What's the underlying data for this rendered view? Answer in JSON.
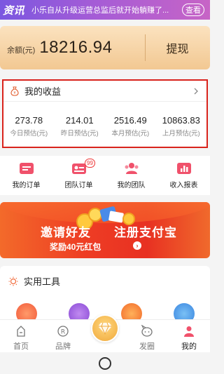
{
  "news": {
    "tag": "资讯",
    "text": "小乐自从升级运营总监后就开始躺赚了...",
    "button": "查看"
  },
  "balance": {
    "label": "余额(元)",
    "value": "18216.94",
    "withdraw": "提现"
  },
  "earnings": {
    "title": "我的收益",
    "stats": [
      {
        "value": "273.78",
        "label": "今日预估(元)"
      },
      {
        "value": "214.01",
        "label": "昨日预估(元)"
      },
      {
        "value": "2516.49",
        "label": "本月预估(元)"
      },
      {
        "value": "10863.83",
        "label": "上月预估(元)"
      }
    ]
  },
  "menu": {
    "items": [
      {
        "label": "我的订单",
        "icon": "order-icon"
      },
      {
        "label": "团队订单",
        "icon": "team-order-icon",
        "badge": "99"
      },
      {
        "label": "我的团队",
        "icon": "team-icon"
      },
      {
        "label": "收入报表",
        "icon": "report-icon"
      }
    ]
  },
  "banner": {
    "line1a": "邀请好友",
    "line1b": "注册支付宝",
    "line2": "奖励40元红包",
    "go": "›"
  },
  "tools": {
    "title": "实用工具"
  },
  "tabbar": {
    "items": [
      {
        "label": "首页",
        "icon": "home-icon"
      },
      {
        "label": "品牌",
        "icon": "brand-icon"
      },
      {
        "label": "",
        "icon": "diamond-icon"
      },
      {
        "label": "发圈",
        "icon": "moments-icon"
      },
      {
        "label": "我的",
        "icon": "profile-icon",
        "active": true
      }
    ]
  },
  "colors": {
    "accent_red": "#d9231c",
    "gold": "#f2c892",
    "news_purple": "#8a5ae0"
  }
}
